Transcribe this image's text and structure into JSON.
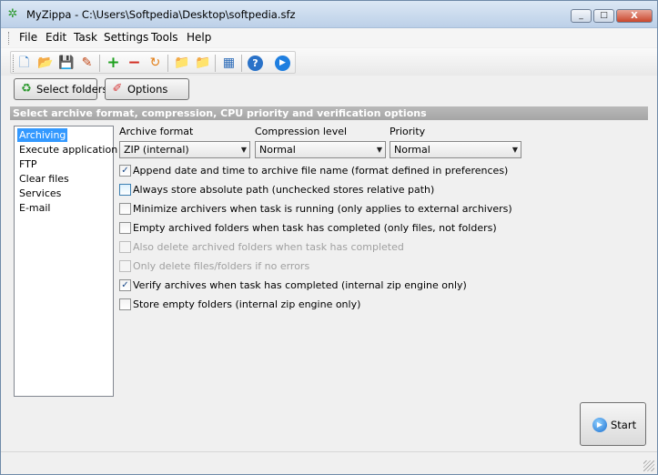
{
  "window": {
    "title": "MyZippa - C:\\Users\\Softpedia\\Desktop\\softpedia.sfz",
    "minimize_glyph": "_",
    "maximize_glyph": "□",
    "close_glyph": "X"
  },
  "menu": [
    "File",
    "Edit",
    "Task",
    "Settings",
    "Tools",
    "Help"
  ],
  "toolbar": {
    "icons": [
      "new-icon",
      "open-icon",
      "save-icon",
      "edit-icon",
      "add-icon",
      "remove-icon",
      "refresh-icon",
      "folder-icon",
      "new-folder-icon",
      "properties-icon",
      "help-icon",
      "run-icon"
    ]
  },
  "buttons": {
    "select_folders": "Select folders",
    "options": "Options",
    "start": "Start"
  },
  "section_header": "Select archive format, compression, CPU priority and verification options",
  "nav": {
    "items": [
      "Archiving",
      "Execute application",
      "FTP",
      "Clear files",
      "Services",
      "E-mail"
    ],
    "selected": "Archiving"
  },
  "fields": {
    "archive_format": {
      "label": "Archive format",
      "value": "ZIP (internal)"
    },
    "compression_level": {
      "label": "Compression level",
      "value": "Normal"
    },
    "priority": {
      "label": "Priority",
      "value": "Normal"
    }
  },
  "options": [
    {
      "label": "Append date and time to archive file name (format defined in preferences)",
      "checked": true,
      "enabled": true
    },
    {
      "label": "Always store absolute path (unchecked stores relative path)",
      "checked": false,
      "enabled": true
    },
    {
      "label": "Minimize archivers when task is running (only applies to external archivers)",
      "checked": false,
      "enabled": true
    },
    {
      "label": "Empty archived folders when task has completed (only files, not folders)",
      "checked": false,
      "enabled": true
    },
    {
      "label": "Also delete archived folders when task has completed",
      "checked": false,
      "enabled": false
    },
    {
      "label": "Only delete files/folders if no errors",
      "checked": false,
      "enabled": false
    },
    {
      "label": "Verify archives when task has completed (internal zip engine only)",
      "checked": true,
      "enabled": true
    },
    {
      "label": "Store empty folders (internal zip engine only)",
      "checked": false,
      "enabled": true
    }
  ],
  "colors": {
    "selection": "#3399ff",
    "section_header": "#a8a8a8",
    "title_bar": "#c6d7ec"
  }
}
